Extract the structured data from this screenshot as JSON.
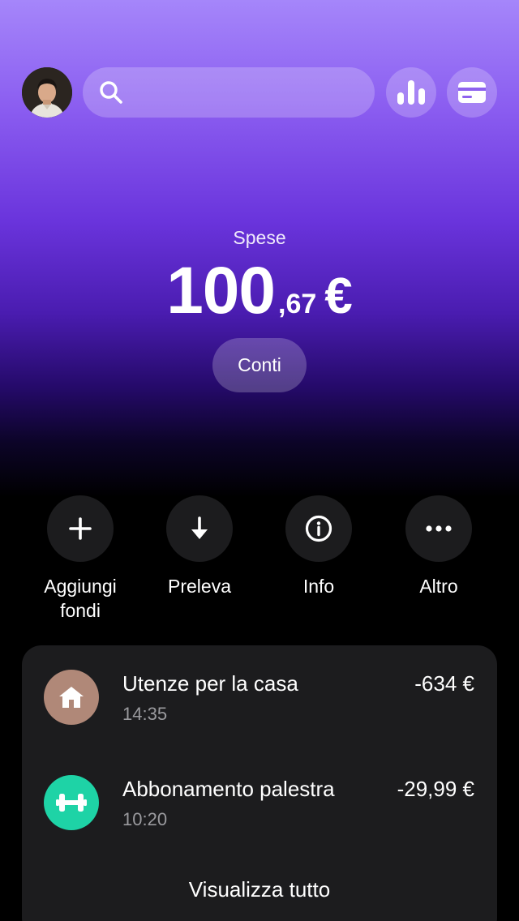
{
  "header": {
    "avatar_icon": "user-avatar",
    "search": {
      "placeholder": "",
      "icon": "search-icon"
    },
    "stats_icon": "bar-chart-icon",
    "card_icon": "credit-card-icon"
  },
  "balance": {
    "label": "Spese",
    "integer": "100",
    "decimal": ",67",
    "currency": "€",
    "accounts_button": "Conti"
  },
  "actions": [
    {
      "label": "Aggiungi fondi",
      "icon": "plus-icon"
    },
    {
      "label": "Preleva",
      "icon": "arrow-down-icon"
    },
    {
      "label": "Info",
      "icon": "info-icon"
    },
    {
      "label": "Altro",
      "icon": "more-icon"
    }
  ],
  "transactions": [
    {
      "title": "Utenze per la casa",
      "time": "14:35",
      "amount": "-634 €",
      "icon": "home-icon",
      "color": "#b08878"
    },
    {
      "title": "Abbonamento palestra",
      "time": "10:20",
      "amount": "-29,99 €",
      "icon": "dumbbell-icon",
      "color": "#1ed3a6"
    }
  ],
  "view_all": "Visualizza tutto",
  "colors": {
    "card_bg": "#1c1c1e",
    "gradient_top": "#a586fa",
    "gradient_mid": "#4a1cb0",
    "background": "#000000"
  }
}
